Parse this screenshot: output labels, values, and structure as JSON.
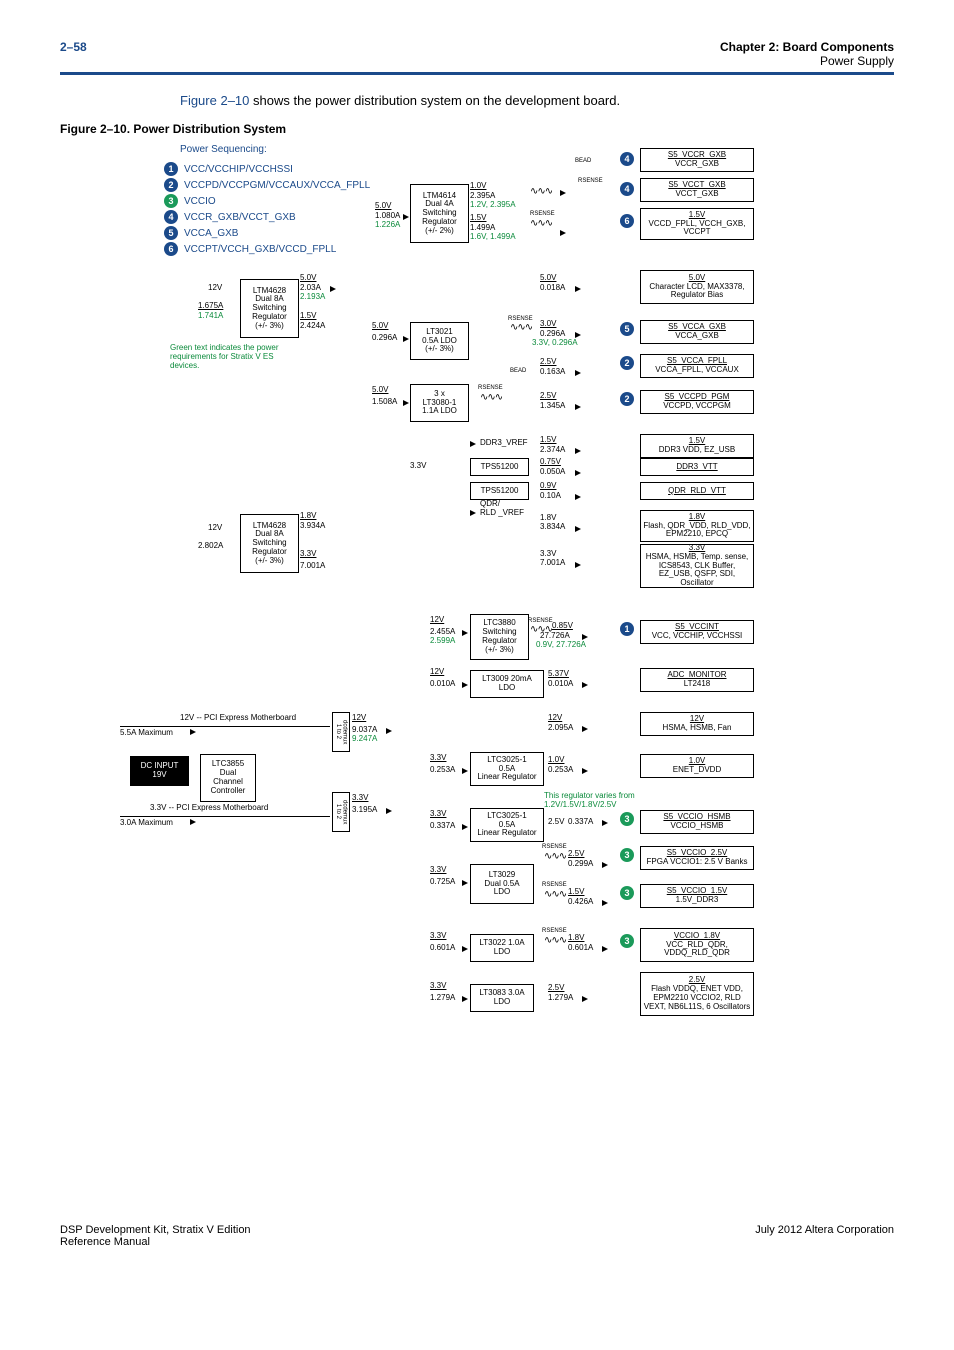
{
  "header": {
    "page": "2–58",
    "chapter": "Chapter 2: Board Components",
    "section": "Power Supply"
  },
  "intro": {
    "prefix": "",
    "link": "Figure 2–10",
    "suffix": " shows the power distribution system on the development board."
  },
  "figcap": "Figure 2–10. Power Distribution System",
  "seqTitle": "Power Sequencing:",
  "seq": [
    {
      "n": "1",
      "t": "VCC/VCCHIP/VCCHSSI"
    },
    {
      "n": "2",
      "t": "VCCPD/VCCPGM/VCCAUX/VCCA_FPLL"
    },
    {
      "n": "3",
      "t": "VCCIO"
    },
    {
      "n": "4",
      "t": "VCCR_GXB/VCCT_GXB"
    },
    {
      "n": "5",
      "t": "VCCA_GXB"
    },
    {
      "n": "6",
      "t": "VCCPT/VCCH_GXB/VCCD_FPLL"
    }
  ],
  "note": "Green text indicates the power requirements for Stratix V ES devices.",
  "regnote": "This regulator varies from 1.2V/1.5V/1.8V/2.5V",
  "labels": {
    "ltm4614": "LTM4614\nDual 4A\nSwitching\nRegulator\n(+/- 2%)",
    "ltm4628a": "LTM4628\nDual 8A\nSwitching\nRegulator\n(+/- 3%)",
    "ltm4628b": "LTM4628\nDual 8A\nSwitching\nRegulator\n(+/- 3%)",
    "lt3021": "LT3021\n0.5A LDO\n(+/- 3%)",
    "lt3080": "3 x\nLT3080-1\n1.1A LDO",
    "tps1": "TPS51200",
    "tps2": "TPS51200",
    "ltc3880": "LTC3880\nSwitching\nRegulator\n(+/- 3%)",
    "lt3009": "LT3009 20mA\nLDO",
    "ltc3855": "LTC3855\nDual\nChannel\nController",
    "ltc3025a": "LTC3025-1\n0.5A\nLinear Regulator",
    "ltc3025b": "LTC3025-1\n0.5A\nLinear Regulator",
    "lt3029": "LT3029\nDual 0.5A\nLDO",
    "lt3022": "LT3022 1.0A\nLDO",
    "lt3083": "LT3083 3.0A\nLDO",
    "ddr3vref": "DDR3_VREF",
    "qdrvref": "QDR/\nRLD _VREF",
    "dcin": "DC INPUT\n19V",
    "pci12": "12V -- PCI Express Motherboard",
    "pci33": "3.3V -- PCI Express Motherboard",
    "max55": "5.5A Maximum",
    "max30": "3.0A Maximum",
    "mux1": "dcdemux\n1 to 2",
    "mux2": "dcdemux\n1 to 2",
    "bead": "BEAD",
    "rsense": "RSENSE"
  },
  "rails": {
    "v50_1080": "5.0V",
    "a1080": "1.080A",
    "g1226": "1.226A",
    "v10": "1.0V",
    "a2395": "2.395A",
    "g12_2395": "1.2V, 2.395A",
    "v15a": "1.5V",
    "a1499": "1.499A",
    "g16_1499": "1.6V, 1.499A",
    "v12a": "12V",
    "a1675": "1.675A",
    "g1741": "1.741A",
    "v50b": "5.0V",
    "a203": "2.03A",
    "g2193": "2.193A",
    "v15b": "1.5V",
    "a2424": "2.424A",
    "v50c": "5.0V",
    "a0296": "0.296A",
    "v50d": "5.0V",
    "a1508": "1.508A",
    "v50e": "5.0V",
    "a0018": "0.018A",
    "v30": "3.0V",
    "a0296b": "0.296A",
    "g33_0296": "3.3V, 0.296A",
    "v25a": "2.5V",
    "a0163": "0.163A",
    "v25b": "2.5V",
    "a1345": "1.345A",
    "v33a": "3.3V",
    "v15c": "1.5V",
    "a2374": "2.374A",
    "v075": "0.75V",
    "a0050": "0.050A",
    "v09a": "0.9V",
    "a010": "0.10A",
    "v18a": "1.8V",
    "a3934": "3.934A",
    "a3834": "1.8V\n3.834A",
    "v33b": "3.3V",
    "a7001": "7.001A",
    "a7001b": "3.3V\n7.001A",
    "v12b": "12V",
    "a2802": "2.802A",
    "v12c": "12V",
    "a2455": "2.455A",
    "g2599": "2.599A",
    "v085": "0.85V",
    "a27726": "27.726A",
    "g09_27726": "0.9V, 27.726A",
    "v12d": "12V",
    "a0010": "0.010A",
    "v537": "5.37V",
    "a0010b": "0.010A",
    "v12e": "12V",
    "a9037": "9.037A",
    "g9247": "9.247A",
    "v12f": "12V",
    "a2095": "2.095A",
    "v33c": "3.3V",
    "a3195": "3.195A",
    "v33d": "3.3V",
    "a0253": "0.253A",
    "v10b": "1.0V",
    "a0253b": "0.253A",
    "v33e": "3.3V",
    "a0337": "0.337A",
    "v25c": "2.5V",
    "a0337b": "0.337A",
    "v33f": "3.3V",
    "a0725": "0.725A",
    "v25d": "2.5V",
    "a0299": "0.299A",
    "v15d": "1.5V",
    "a0426": "0.426A",
    "v33g": "3.3V",
    "a0601": "0.601A",
    "v18b": "1.8V",
    "a0601b": "0.601A",
    "v33h": "3.3V",
    "a1279": "1.279A",
    "v25e": "2.5V",
    "a1279b": "1.279A"
  },
  "outs": {
    "o1": {
      "t1": "S5_VCCR_GXB",
      "t2": "VCCR_GXB",
      "seq": "4"
    },
    "o2": {
      "t1": "S5_VCCT_GXB",
      "t2": "VCCT_GXB",
      "seq": "4"
    },
    "o3": {
      "t1": "1.5V",
      "t2": "VCCD_FPLL, VCCH_GXB, VCCPT",
      "seq": "6"
    },
    "o4": {
      "t1": "5.0V",
      "t2": "Character LCD, MAX3378, Regulator Bias"
    },
    "o5": {
      "t1": "S5_VCCA_GXB",
      "t2": "VCCA_GXB",
      "seq": "5"
    },
    "o6": {
      "t1": "S5_VCCA_FPLL",
      "t2": "VCCA_FPLL, VCCAUX",
      "seq": "2"
    },
    "o7": {
      "t1": "S5_VCCPD_PGM",
      "t2": "VCCPD, VCCPGM",
      "seq": "2"
    },
    "o8": {
      "t1": "1.5V",
      "t2": "DDR3 VDD, EZ_USB"
    },
    "o9": {
      "t1": "DDR3_VTT",
      "t2": ""
    },
    "o10": {
      "t1": "QDR_RLD_VTT",
      "t2": ""
    },
    "o11": {
      "t1": "1.8V",
      "t2": "Flash, QDR_VDD, RLD_VDD, EPM2210, EPCQ"
    },
    "o12": {
      "t1": "3.3V",
      "t2": "HSMA, HSMB, Temp. sense, ICS8543, CLK Buffer, EZ_USB, QSFP, SDI, Oscillator"
    },
    "o13": {
      "t1": "S5_VCCINT",
      "t2": "VCC, VCCHIP, VCCHSSI",
      "seq": "1"
    },
    "o14": {
      "t1": "ADC_MONITOR",
      "t2": "LT2418"
    },
    "o15": {
      "t1": "12V",
      "t2": "HSMA, HSMB, Fan"
    },
    "o16": {
      "t1": "1.0V",
      "t2": "ENET_DVDD"
    },
    "o17": {
      "t1": "S5_VCCIO_HSMB",
      "t2": "VCCIO_HSMB",
      "seq": "3"
    },
    "o18": {
      "t1": "S5_VCCIO_2.5V",
      "t2": "FPGA VCCIO1: 2.5 V Banks",
      "seq": "3"
    },
    "o19": {
      "t1": "S5_VCCIO_1.5V",
      "t2": "1.5V_DDR3",
      "seq": "3"
    },
    "o20": {
      "t1": "VCCIO_1.8V",
      "t2": "VCC_RLD_QDR, VDDQ_RLD_QDR",
      "seq": "3"
    },
    "o21": {
      "t1": "2.5V",
      "t2": "Flash VDDQ, ENET VDD, EPM2210 VCCIO2, RLD VEXT, NB6L11S, 6 Oscillators"
    }
  },
  "footer": {
    "l1": "DSP Development Kit, Stratix V Edition",
    "l2": "Reference Manual",
    "r": "July 2012   Altera Corporation"
  }
}
